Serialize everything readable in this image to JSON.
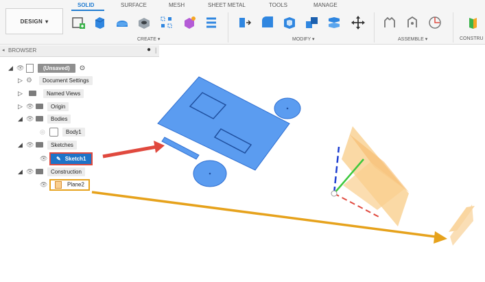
{
  "toolbar": {
    "design_label": "DESIGN",
    "tabs": [
      {
        "label": "SOLID",
        "active": true
      },
      {
        "label": "SURFACE",
        "active": false
      },
      {
        "label": "MESH",
        "active": false
      },
      {
        "label": "SHEET METAL",
        "active": false
      },
      {
        "label": "TOOLS",
        "active": false
      },
      {
        "label": "MANAGE",
        "active": false
      }
    ],
    "groups": {
      "create": "CREATE",
      "modify": "MODIFY",
      "assemble": "ASSEMBLE",
      "construct": "CONSTRU"
    },
    "accent": "#1f7bd1"
  },
  "browser": {
    "title": "BROWSER",
    "root": "(Unsaved)",
    "items": {
      "document_settings": "Document Settings",
      "named_views": "Named Views",
      "origin": "Origin",
      "bodies": "Bodies",
      "body1": "Body1",
      "sketches": "Sketches",
      "sketch1": "Sketch1",
      "construction": "Construction",
      "plane2": "Plane2"
    }
  },
  "colors": {
    "sketch_fill": "#5b9cf0",
    "sketch_stroke": "#2f6fd1",
    "plane_fill": "#f9cf8f",
    "arrow_red": "#e0493e",
    "arrow_gold": "#e6a21c",
    "highlight_blue": "#1e73c8"
  }
}
